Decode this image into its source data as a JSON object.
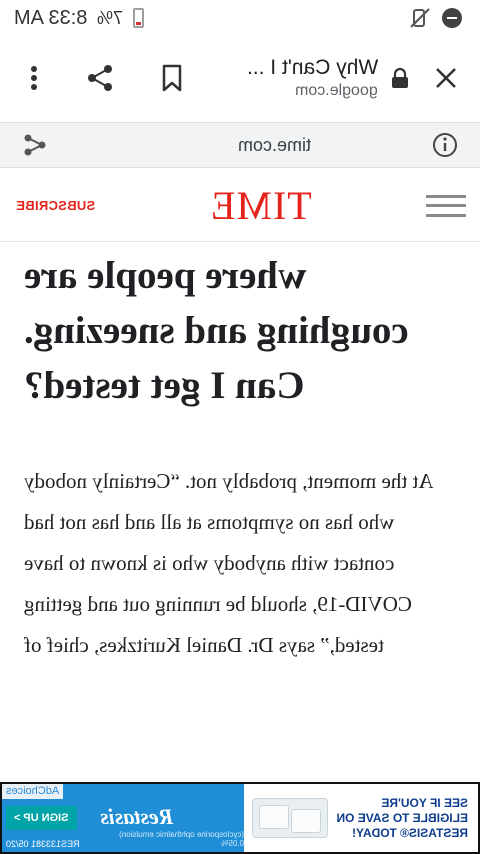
{
  "status_bar": {
    "time": "8:33 AM",
    "battery": "7%"
  },
  "toolbar": {
    "page_title": "Why Can't I ...",
    "domain": "google.com",
    "icons": [
      "close-icon",
      "lock-icon",
      "bookmark-icon",
      "share-icon",
      "more-vert-icon"
    ]
  },
  "url_bar": {
    "url": "time.com",
    "icons": [
      "info-icon",
      "share-icon"
    ]
  },
  "site_header": {
    "logo": "TIME",
    "subscribe_label": "SUBSCRIBE",
    "brand_color": "#e5231b"
  },
  "article": {
    "headline": "where people are coughing and sneezing. Can I get tested?",
    "body": "At the moment, probably not. “Certainly nobody who has no symptoms at all and has not had contact with anybody who is known to have COVID-19, should be running out and getting tested,” says Dr. Daniel Kuritzkes, chief of"
  },
  "ad": {
    "adchoices": "AdChoices",
    "signup_label": "SIGN UP >",
    "brand": "Restasis",
    "brand_sub": "(cyclosporine ophthalmic emulsion) 0.05%",
    "code": "RES133381 05/20",
    "cta": "SEE IF YOU'RE ELIGIBLE TO SAVE ON RESTASIS® TODAY!",
    "colors": {
      "ad_blue": "#1f8ed6",
      "signup_teal": "#00a3a6",
      "cta_navy": "#0d3d8c"
    }
  }
}
